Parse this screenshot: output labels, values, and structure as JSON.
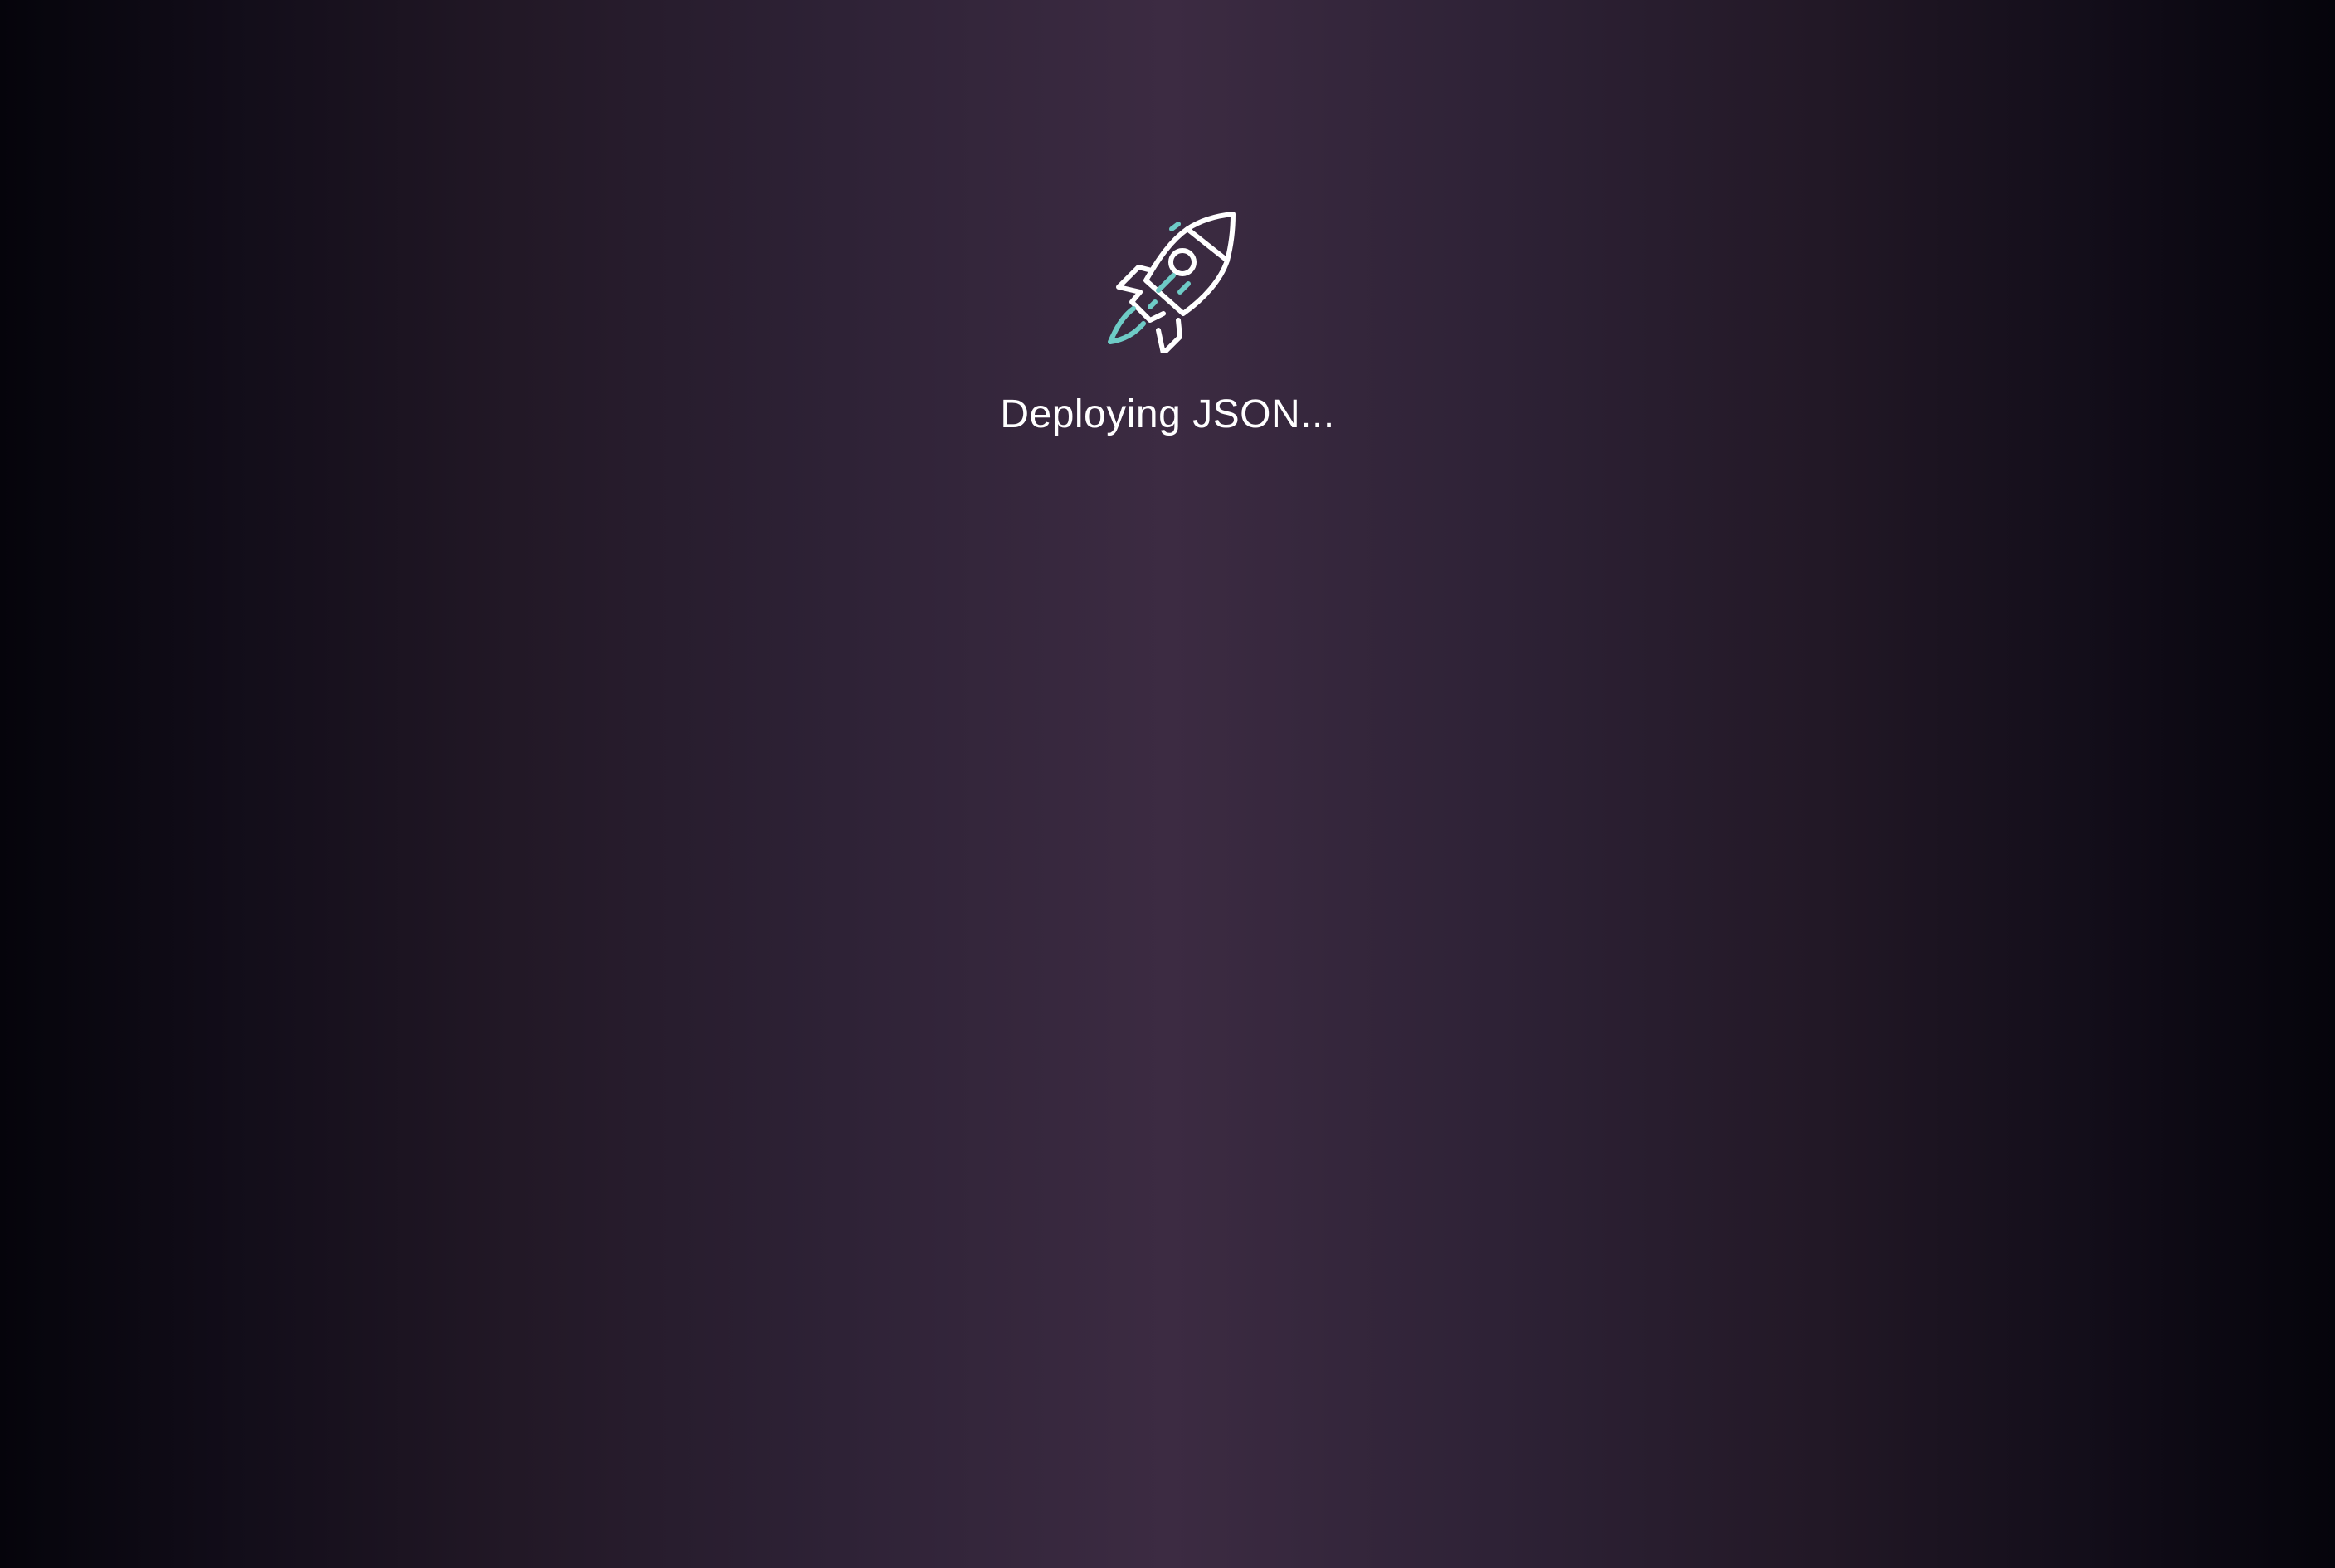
{
  "loader": {
    "status_text": "Deploying JSON...",
    "icon": "rocket-icon"
  },
  "colors": {
    "background_center": "#3c2b42",
    "background_edge": "#05040b",
    "icon_stroke": "#ffffff",
    "icon_accent": "#6ecbc6",
    "text": "#ffffff"
  }
}
